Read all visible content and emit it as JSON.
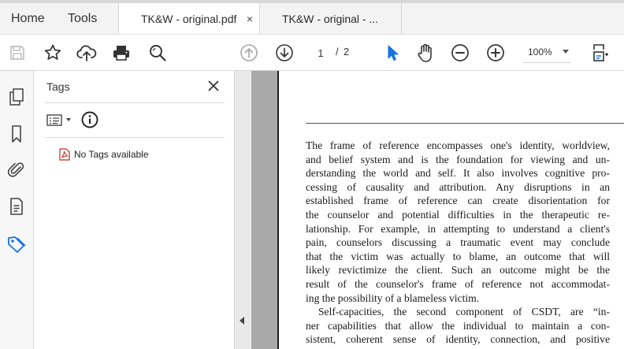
{
  "tabbar": {
    "home_label": "Home",
    "tools_label": "Tools",
    "active_tab_label": "TK&W - original.pdf",
    "active_tab_close": "×",
    "inactive_tab_label": "TK&W - original - ..."
  },
  "toolbar": {
    "icons": [
      "save-icon",
      "bookmark-star-icon",
      "cloud-upload-icon",
      "print-icon",
      "search-icon",
      "previous-page-icon",
      "next-page-icon",
      "select-cursor-icon",
      "hand-tool-icon",
      "zoom-out-icon",
      "zoom-in-icon",
      "fit-page-icon"
    ],
    "current_page": "1",
    "page_separator": "/",
    "page_total": "2",
    "zoom_value": "100%"
  },
  "left_rail": {
    "items": [
      "pages-icon",
      "bookmarks-icon",
      "attachments-icon",
      "document-icon",
      "tags-icon"
    ],
    "active": "tags-icon",
    "accent_color": "#1473e6"
  },
  "tags_panel": {
    "title": "Tags",
    "close": "×",
    "empty_message": "No Tags available"
  },
  "document": {
    "lines": [
      "The frame of reference encompasses one's identity, worldview,",
      "and belief system and is the foundation for viewing and un-",
      "derstanding the world and self. It also involves cognitive pro-",
      "cessing of causality and attribution. Any disruptions in an",
      "established frame of reference can create disorientation for",
      "the counselor and potential difficulties in the therapeutic re-",
      "lationship. For example, in attempting to understand a client's",
      "pain, counselors discussing a traumatic event may conclude",
      "that the victim was actually to blame, an outcome that will",
      "likely revictimize the client. Such an outcome might be the",
      "result of the counselor's frame of reference not accommodat-",
      "ing the possibility of a blameless victim.",
      "Self-capacities, the second component of CSDT, are “in-",
      "ner capabilities that allow the individual to maintain a con-",
      "sistent, coherent sense of identity, connection, and positive"
    ]
  }
}
